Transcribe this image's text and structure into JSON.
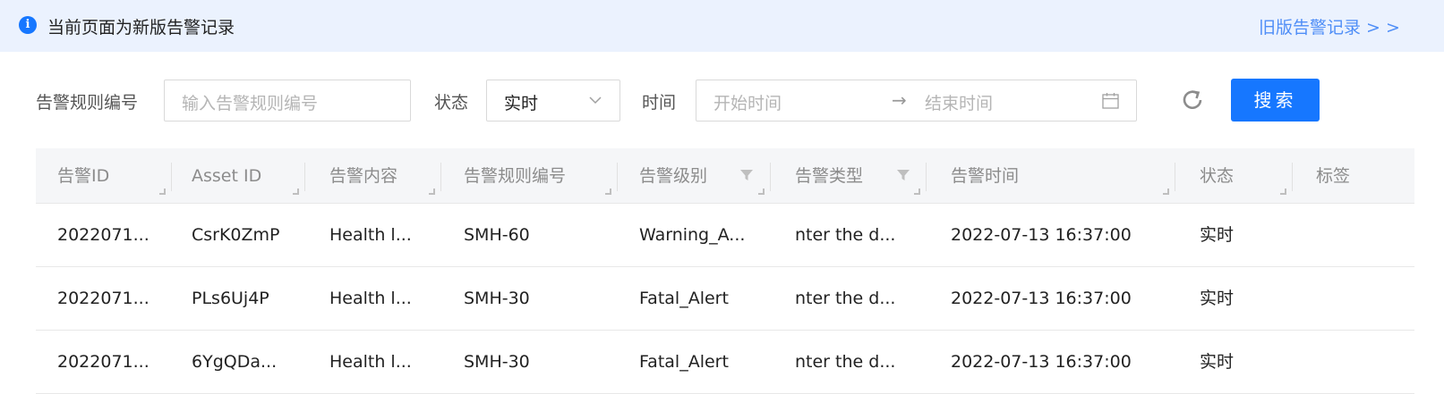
{
  "notice": {
    "icon": "info-icon",
    "text": "当前页面为新版告警记录",
    "link": "旧版告警记录 > >"
  },
  "filters": {
    "rule_label": "告警规则编号",
    "rule_placeholder": "输入告警规则编号",
    "status_label": "状态",
    "status_value": "实时",
    "time_label": "时间",
    "start_placeholder": "开始时间",
    "range_separator": "→",
    "end_placeholder": "结束时间",
    "search_button": "搜索"
  },
  "table": {
    "columns": [
      "告警ID",
      "Asset ID",
      "告警内容",
      "告警规则编号",
      "告警级别",
      "告警类型",
      "告警时间",
      "状态",
      "标签"
    ],
    "rows": [
      [
        "2022071...",
        "CsrK0ZmP",
        "Health l...",
        "SMH-60",
        "Warning_A...",
        "nter the d...",
        "2022-07-13 16:37:00",
        "实时",
        ""
      ],
      [
        "2022071...",
        "PLs6Uj4P",
        "Health l...",
        "SMH-30",
        "Fatal_Alert",
        "nter the d...",
        "2022-07-13 16:37:00",
        "实时",
        ""
      ],
      [
        "2022071...",
        "6YgQDa...",
        "Health l...",
        "SMH-30",
        "Fatal_Alert",
        "nter the d...",
        "2022-07-13 16:37:00",
        "实时",
        ""
      ]
    ]
  },
  "colors": {
    "accent": "#1677ff",
    "notice_bg": "#ebf2fe",
    "link": "#4f8ef7",
    "header_bg": "#f5f6f8"
  }
}
